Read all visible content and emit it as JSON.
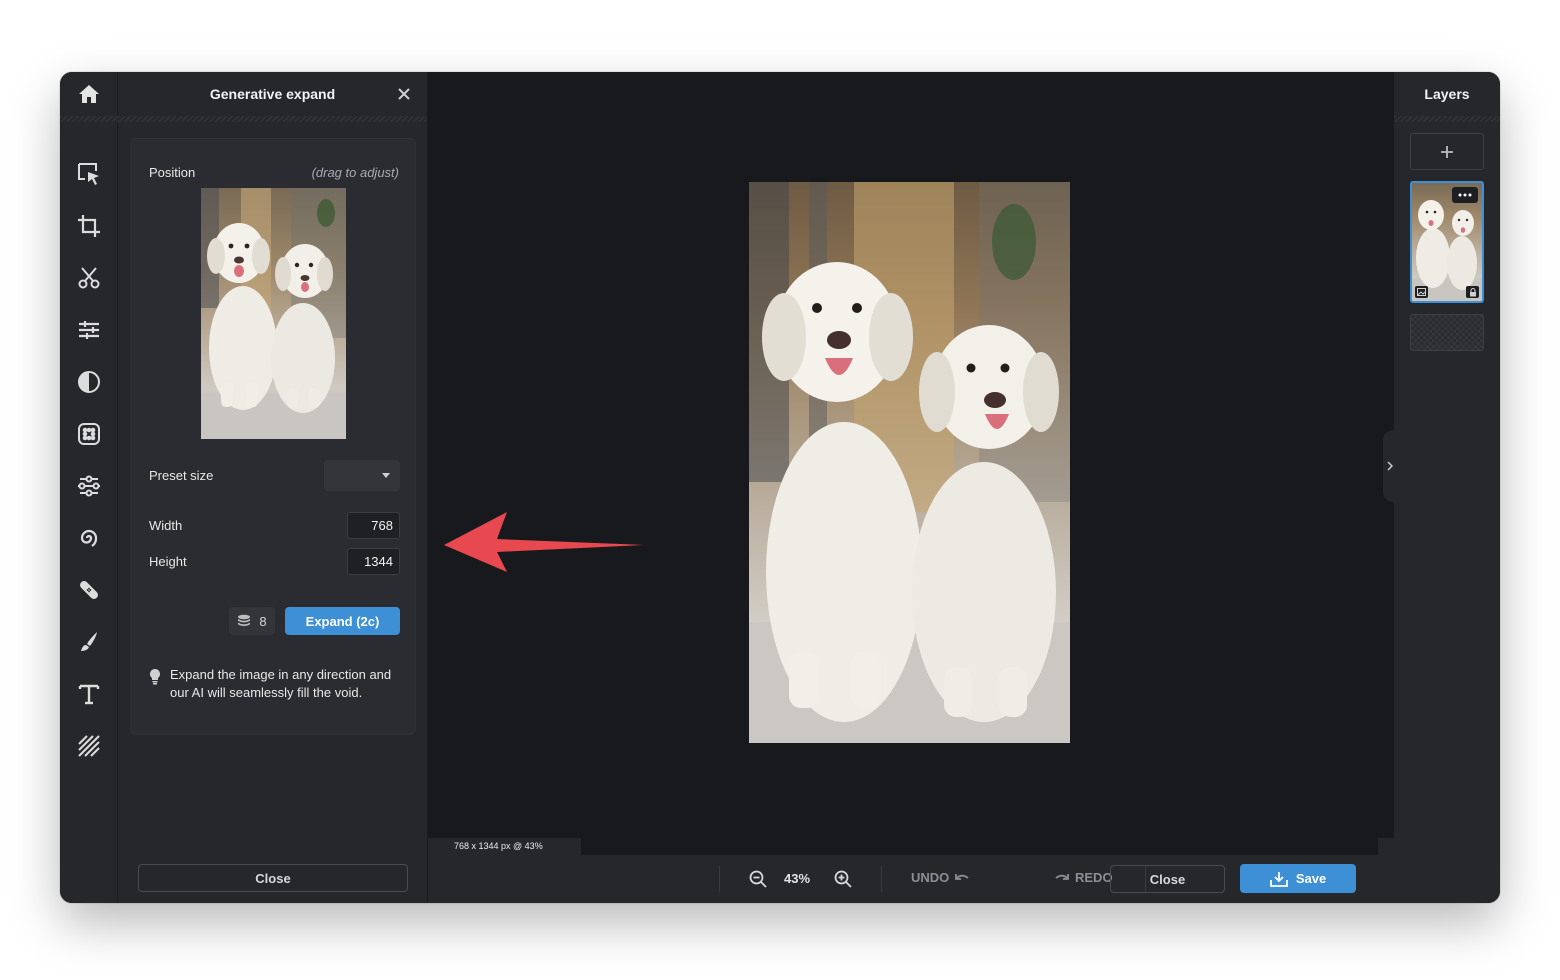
{
  "panel": {
    "title": "Generative expand",
    "position_label": "Position",
    "drag_hint": "(drag to adjust)",
    "preset_label": "Preset size",
    "preset_value": "",
    "width_label": "Width",
    "width_value": "768",
    "height_label": "Height",
    "height_value": "1344",
    "credits_count": "8",
    "expand_button": "Expand (2c)",
    "tip": "Expand the image in any direction and our AI will seamlessly fill the void.",
    "close_button": "Close"
  },
  "tools": [
    "home-icon",
    "select-icon",
    "crop-icon",
    "cut-icon",
    "adjust-icon",
    "contrast-icon",
    "filter-icon",
    "effects-icon",
    "liquify-icon",
    "heal-icon",
    "brush-icon",
    "text-icon",
    "pattern-icon"
  ],
  "canvas": {
    "status": "768 x 1344 px @ 43%"
  },
  "bottombar": {
    "zoom": "43%",
    "undo": "UNDO",
    "redo": "REDO",
    "close": "Close",
    "save": "Save"
  },
  "layers": {
    "title": "Layers"
  },
  "colors": {
    "accent": "#3d8fd6",
    "arrow": "#e8484f",
    "background": "#26272b",
    "canvas": "#18191c"
  }
}
